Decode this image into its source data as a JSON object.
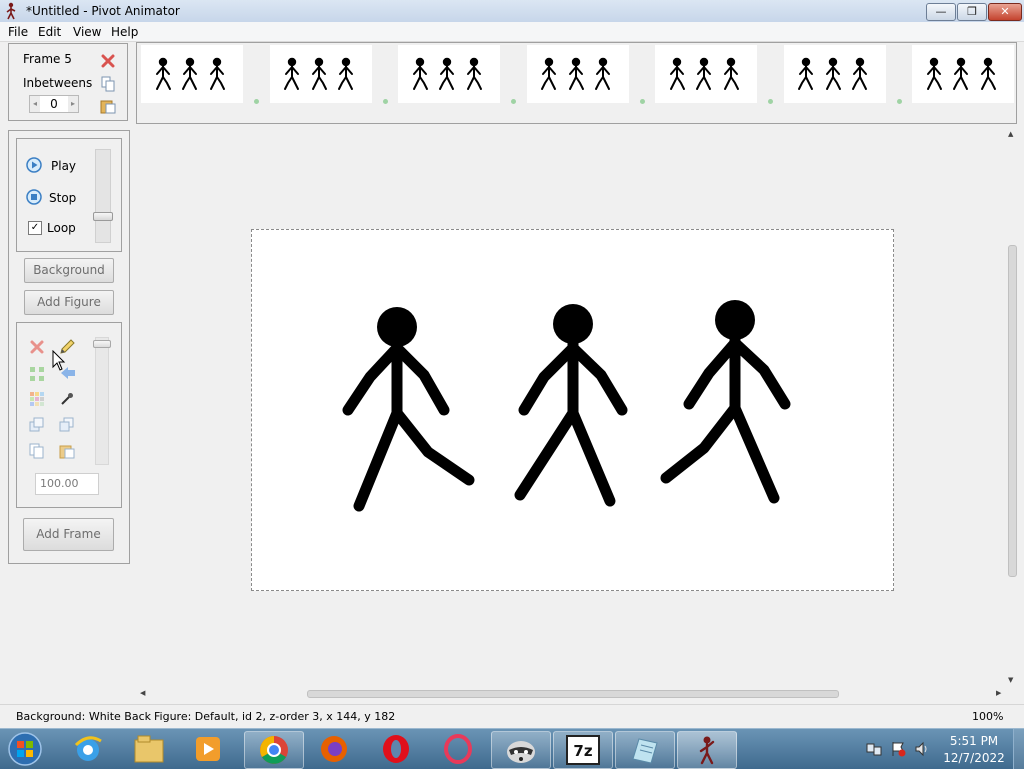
{
  "window": {
    "title": "*Untitled - Pivot Animator",
    "min_label": "—",
    "max_label": "❐",
    "close_label": "✕"
  },
  "menu": {
    "items": [
      "File",
      "Edit",
      "View",
      "Help"
    ]
  },
  "frame_panel": {
    "frame_label": "Frame 5",
    "inbetweens_label": "Inbetweens",
    "inbetweens_value": "0"
  },
  "playback": {
    "play_label": "Play",
    "stop_label": "Stop",
    "loop_label": "Loop",
    "loop_checked": true
  },
  "buttons": {
    "background": "Background",
    "add_figure": "Add Figure",
    "add_frame": "Add Frame"
  },
  "figure_tools": {
    "scale_value": "100.00"
  },
  "timeline": {
    "frame_count": 7,
    "figures_per_frame": 3
  },
  "status": {
    "background": "Background: White Back",
    "figure": "Figure: Default,  id 2,  z-order 3,  x 144, y 182",
    "zoom": "100%"
  },
  "taskbar": {
    "time": "5:51 PM",
    "date": "12/7/2022",
    "apps": [
      "start-orb",
      "internet-explorer",
      "file-explorer",
      "media-player",
      "chrome",
      "firefox",
      "opera",
      "opera-gx",
      "raccoon-app",
      "7zip",
      "notepad",
      "pivot-animator"
    ]
  },
  "colors": {
    "figure": "#000000",
    "accent": "#3b7fc4",
    "close": "#c4432e",
    "taskbar": "#3f6a8e"
  }
}
